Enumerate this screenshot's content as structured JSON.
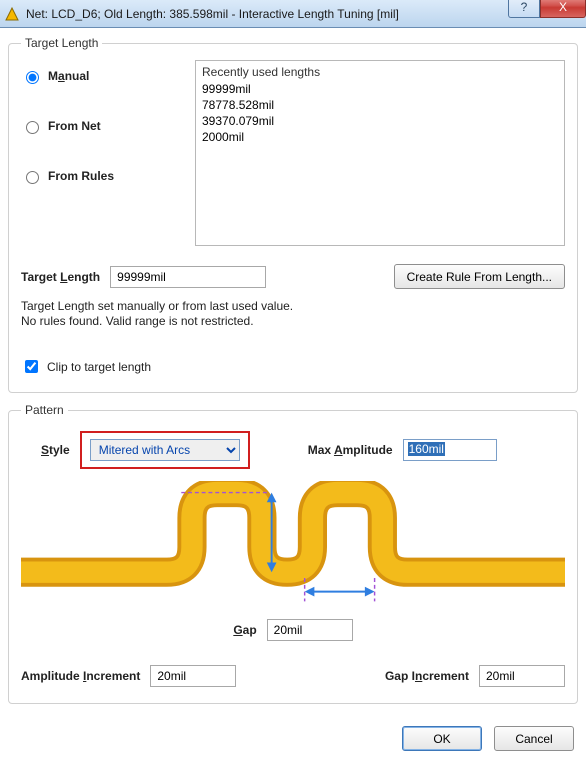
{
  "window": {
    "title": "Net: LCD_D6;  Old Length: 385.598mil -  Interactive Length Tuning [mil]",
    "help": "?",
    "close": "X"
  },
  "target_length": {
    "legend": "Target Length",
    "manual_pre": "M",
    "manual_u": "a",
    "manual_post": "nual",
    "from_net": "From Net",
    "from_rules": "From Rules",
    "list_header": "Recently used lengths",
    "items": [
      "99999mil",
      "78778.528mil",
      "39370.079mil",
      "2000mil"
    ],
    "target_pre": "Target ",
    "target_u": "L",
    "target_post": "ength",
    "target_value": "99999mil",
    "create_rule": "Create Rule From Length...",
    "note1": "Target Length set manually or from last used value.",
    "note2": " No rules found. Valid range is not restricted.",
    "clip": "Clip to target length"
  },
  "pattern": {
    "legend": "Pattern",
    "style_u": "S",
    "style_post": "tyle",
    "style_value": "Mitered with Arcs",
    "maxamp_pre": "Max ",
    "maxamp_u": "A",
    "maxamp_post": "mplitude",
    "maxamp_value": "160mil",
    "gap_u": "G",
    "gap_post": "ap",
    "gap_value": "20mil",
    "ampinc_pre": "Amplitude ",
    "ampinc_u": "I",
    "ampinc_post": "ncrement",
    "ampinc_value": "20mil",
    "gapinc_pre": "Gap I",
    "gapinc_u": "n",
    "gapinc_post": "crement",
    "gapinc_value": "20mil"
  },
  "footer": {
    "ok": "OK",
    "cancel": "Cancel"
  }
}
